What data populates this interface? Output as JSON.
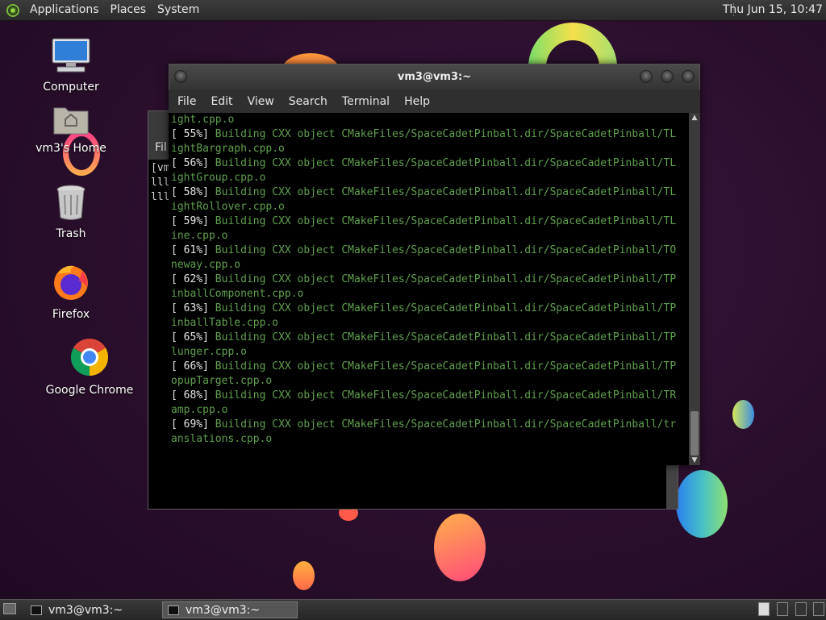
{
  "top_panel": {
    "menus": [
      "Applications",
      "Places",
      "System"
    ],
    "clock": "Thu Jun 15, 10:47"
  },
  "desktop": {
    "icons": [
      {
        "label": "Computer",
        "icon": "computer-icon"
      },
      {
        "label": "vm3's Home",
        "icon": "home-folder-icon"
      },
      {
        "label": "Trash",
        "icon": "trash-icon"
      },
      {
        "label": "Firefox",
        "icon": "firefox-icon"
      },
      {
        "label": "Google Chrome",
        "icon": "chrome-icon"
      }
    ]
  },
  "back_terminal": {
    "menu_fragment": "Fil",
    "lines": [
      "[vm",
      "lll",
      "lll"
    ]
  },
  "terminal": {
    "title": "vm3@vm3:~",
    "menu": [
      "File",
      "Edit",
      "View",
      "Search",
      "Terminal",
      "Help"
    ],
    "lines": [
      {
        "pct": "",
        "text": "ight.cpp.o"
      },
      {
        "pct": "[ 55%] ",
        "text": "Building CXX object CMakeFiles/SpaceCadetPinball.dir/SpaceCadetPinball/TL"
      },
      {
        "pct": "",
        "text": "ightBargraph.cpp.o"
      },
      {
        "pct": "[ 56%] ",
        "text": "Building CXX object CMakeFiles/SpaceCadetPinball.dir/SpaceCadetPinball/TL"
      },
      {
        "pct": "",
        "text": "ightGroup.cpp.o"
      },
      {
        "pct": "[ 58%] ",
        "text": "Building CXX object CMakeFiles/SpaceCadetPinball.dir/SpaceCadetPinball/TL"
      },
      {
        "pct": "",
        "text": "ightRollover.cpp.o"
      },
      {
        "pct": "[ 59%] ",
        "text": "Building CXX object CMakeFiles/SpaceCadetPinball.dir/SpaceCadetPinball/TL"
      },
      {
        "pct": "",
        "text": "ine.cpp.o"
      },
      {
        "pct": "[ 61%] ",
        "text": "Building CXX object CMakeFiles/SpaceCadetPinball.dir/SpaceCadetPinball/TO"
      },
      {
        "pct": "",
        "text": "neway.cpp.o"
      },
      {
        "pct": "[ 62%] ",
        "text": "Building CXX object CMakeFiles/SpaceCadetPinball.dir/SpaceCadetPinball/TP"
      },
      {
        "pct": "",
        "text": "inballComponent.cpp.o"
      },
      {
        "pct": "[ 63%] ",
        "text": "Building CXX object CMakeFiles/SpaceCadetPinball.dir/SpaceCadetPinball/TP"
      },
      {
        "pct": "",
        "text": "inballTable.cpp.o"
      },
      {
        "pct": "[ 65%] ",
        "text": "Building CXX object CMakeFiles/SpaceCadetPinball.dir/SpaceCadetPinball/TP"
      },
      {
        "pct": "",
        "text": "lunger.cpp.o"
      },
      {
        "pct": "[ 66%] ",
        "text": "Building CXX object CMakeFiles/SpaceCadetPinball.dir/SpaceCadetPinball/TP"
      },
      {
        "pct": "",
        "text": "opupTarget.cpp.o"
      },
      {
        "pct": "[ 68%] ",
        "text": "Building CXX object CMakeFiles/SpaceCadetPinball.dir/SpaceCadetPinball/TR"
      },
      {
        "pct": "",
        "text": "amp.cpp.o"
      },
      {
        "pct": "[ 69%] ",
        "text": "Building CXX object CMakeFiles/SpaceCadetPinball.dir/SpaceCadetPinball/tr"
      },
      {
        "pct": "",
        "text": "anslations.cpp.o"
      }
    ]
  },
  "taskbar": {
    "tasks": [
      {
        "label": "vm3@vm3:~",
        "icon": "terminal-icon"
      },
      {
        "label": "vm3@vm3:~",
        "icon": "terminal-icon"
      }
    ]
  },
  "colors": {
    "terminal_text_green": "#5fa04e",
    "terminal_bg": "#000000",
    "panel_bg": "#333333"
  }
}
